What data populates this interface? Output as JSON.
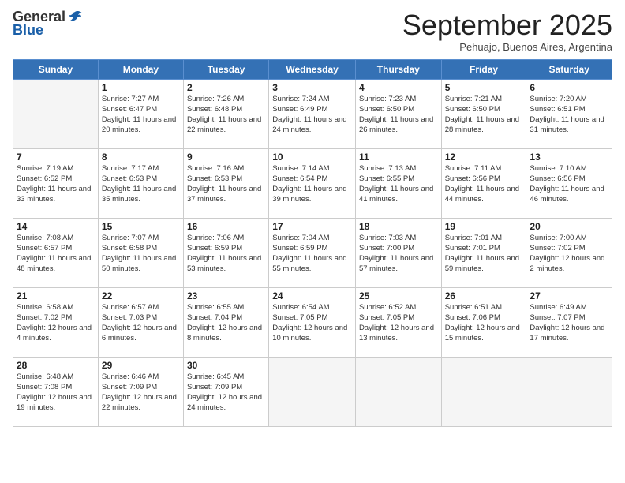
{
  "logo": {
    "general": "General",
    "blue": "Blue"
  },
  "header": {
    "month": "September 2025",
    "location": "Pehuajo, Buenos Aires, Argentina"
  },
  "days_of_week": [
    "Sunday",
    "Monday",
    "Tuesday",
    "Wednesday",
    "Thursday",
    "Friday",
    "Saturday"
  ],
  "weeks": [
    [
      {
        "day": "",
        "empty": true
      },
      {
        "day": "1",
        "sunrise": "7:27 AM",
        "sunset": "6:47 PM",
        "daylight": "11 hours and 20 minutes."
      },
      {
        "day": "2",
        "sunrise": "7:26 AM",
        "sunset": "6:48 PM",
        "daylight": "11 hours and 22 minutes."
      },
      {
        "day": "3",
        "sunrise": "7:24 AM",
        "sunset": "6:49 PM",
        "daylight": "11 hours and 24 minutes."
      },
      {
        "day": "4",
        "sunrise": "7:23 AM",
        "sunset": "6:50 PM",
        "daylight": "11 hours and 26 minutes."
      },
      {
        "day": "5",
        "sunrise": "7:21 AM",
        "sunset": "6:50 PM",
        "daylight": "11 hours and 28 minutes."
      },
      {
        "day": "6",
        "sunrise": "7:20 AM",
        "sunset": "6:51 PM",
        "daylight": "11 hours and 31 minutes."
      }
    ],
    [
      {
        "day": "7",
        "sunrise": "7:19 AM",
        "sunset": "6:52 PM",
        "daylight": "11 hours and 33 minutes."
      },
      {
        "day": "8",
        "sunrise": "7:17 AM",
        "sunset": "6:53 PM",
        "daylight": "11 hours and 35 minutes."
      },
      {
        "day": "9",
        "sunrise": "7:16 AM",
        "sunset": "6:53 PM",
        "daylight": "11 hours and 37 minutes."
      },
      {
        "day": "10",
        "sunrise": "7:14 AM",
        "sunset": "6:54 PM",
        "daylight": "11 hours and 39 minutes."
      },
      {
        "day": "11",
        "sunrise": "7:13 AM",
        "sunset": "6:55 PM",
        "daylight": "11 hours and 41 minutes."
      },
      {
        "day": "12",
        "sunrise": "7:11 AM",
        "sunset": "6:56 PM",
        "daylight": "11 hours and 44 minutes."
      },
      {
        "day": "13",
        "sunrise": "7:10 AM",
        "sunset": "6:56 PM",
        "daylight": "11 hours and 46 minutes."
      }
    ],
    [
      {
        "day": "14",
        "sunrise": "7:08 AM",
        "sunset": "6:57 PM",
        "daylight": "11 hours and 48 minutes."
      },
      {
        "day": "15",
        "sunrise": "7:07 AM",
        "sunset": "6:58 PM",
        "daylight": "11 hours and 50 minutes."
      },
      {
        "day": "16",
        "sunrise": "7:06 AM",
        "sunset": "6:59 PM",
        "daylight": "11 hours and 53 minutes."
      },
      {
        "day": "17",
        "sunrise": "7:04 AM",
        "sunset": "6:59 PM",
        "daylight": "11 hours and 55 minutes."
      },
      {
        "day": "18",
        "sunrise": "7:03 AM",
        "sunset": "7:00 PM",
        "daylight": "11 hours and 57 minutes."
      },
      {
        "day": "19",
        "sunrise": "7:01 AM",
        "sunset": "7:01 PM",
        "daylight": "11 hours and 59 minutes."
      },
      {
        "day": "20",
        "sunrise": "7:00 AM",
        "sunset": "7:02 PM",
        "daylight": "12 hours and 2 minutes."
      }
    ],
    [
      {
        "day": "21",
        "sunrise": "6:58 AM",
        "sunset": "7:02 PM",
        "daylight": "12 hours and 4 minutes."
      },
      {
        "day": "22",
        "sunrise": "6:57 AM",
        "sunset": "7:03 PM",
        "daylight": "12 hours and 6 minutes."
      },
      {
        "day": "23",
        "sunrise": "6:55 AM",
        "sunset": "7:04 PM",
        "daylight": "12 hours and 8 minutes."
      },
      {
        "day": "24",
        "sunrise": "6:54 AM",
        "sunset": "7:05 PM",
        "daylight": "12 hours and 10 minutes."
      },
      {
        "day": "25",
        "sunrise": "6:52 AM",
        "sunset": "7:05 PM",
        "daylight": "12 hours and 13 minutes."
      },
      {
        "day": "26",
        "sunrise": "6:51 AM",
        "sunset": "7:06 PM",
        "daylight": "12 hours and 15 minutes."
      },
      {
        "day": "27",
        "sunrise": "6:49 AM",
        "sunset": "7:07 PM",
        "daylight": "12 hours and 17 minutes."
      }
    ],
    [
      {
        "day": "28",
        "sunrise": "6:48 AM",
        "sunset": "7:08 PM",
        "daylight": "12 hours and 19 minutes."
      },
      {
        "day": "29",
        "sunrise": "6:46 AM",
        "sunset": "7:09 PM",
        "daylight": "12 hours and 22 minutes."
      },
      {
        "day": "30",
        "sunrise": "6:45 AM",
        "sunset": "7:09 PM",
        "daylight": "12 hours and 24 minutes."
      },
      {
        "day": "",
        "empty": true
      },
      {
        "day": "",
        "empty": true
      },
      {
        "day": "",
        "empty": true
      },
      {
        "day": "",
        "empty": true
      }
    ]
  ]
}
